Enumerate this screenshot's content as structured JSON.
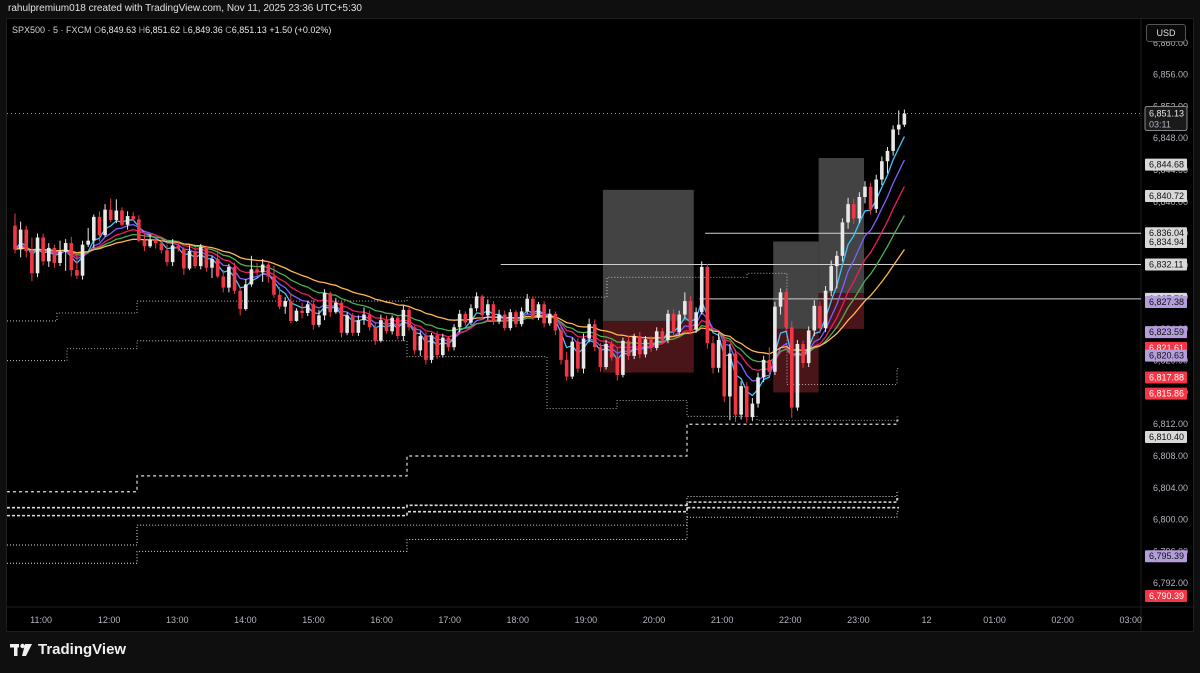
{
  "header": {
    "attribution": "rahulpremium018 created with TradingView.com, Nov 11, 2025 23:36 UTC+5:30"
  },
  "legend": {
    "symbol": "SPX500 · 5 · FXCM",
    "o_label": "O",
    "o_value": "6,849.63",
    "h_label": "H",
    "h_value": "6,851.62",
    "l_label": "L",
    "l_value": "6,849.36",
    "c_label": "C",
    "c_value": "6,851.13",
    "change": "+1.50 (+0.02%)"
  },
  "currency_button": "USD",
  "footer": {
    "brand": "TradingView"
  },
  "colors": {
    "bull": "#e8e8e8",
    "bear": "#f23645",
    "ema_fast": "#40c4ff",
    "ema_2": "#7b61ff",
    "ema_3": "#e91e63",
    "ema_4": "#4caf50",
    "ema_slow": "#ffb74d",
    "zone_grey": "#5a5a5a",
    "zone_red": "#5c1a1f"
  },
  "chart_data": {
    "type": "candlestick",
    "ylim": [
      6789,
      6863
    ],
    "y_ticks": [
      "6,860.00",
      "6,856.00",
      "6,852.00",
      "6,848.00",
      "6,844.00",
      "6,840.00",
      "6,836.00",
      "6,832.00",
      "6,828.00",
      "6,824.00",
      "6,820.00",
      "6,816.00",
      "6,812.00",
      "6,808.00",
      "6,804.00",
      "6,800.00",
      "6,796.00",
      "6,792.00"
    ],
    "x_labels": [
      "11:00",
      "12:00",
      "13:00",
      "14:00",
      "15:00",
      "16:00",
      "17:00",
      "18:00",
      "19:00",
      "20:00",
      "21:00",
      "22:00",
      "23:00",
      "12",
      "01:00",
      "02:00",
      "03:00"
    ],
    "current_price": "6,851.13",
    "countdown": "03:11",
    "price_labels": [
      {
        "value": 6844.68,
        "text": "6,844.68",
        "style": "grey"
      },
      {
        "value": 6840.72,
        "text": "6,840.72",
        "style": "grey"
      },
      {
        "value": 6836.04,
        "text": "6,836.04",
        "style": "grey"
      },
      {
        "value": 6834.94,
        "text": "6,834.94",
        "style": "grey"
      },
      {
        "value": 6832.11,
        "text": "6,832.11",
        "style": "grey"
      },
      {
        "value": 6827.78,
        "text": "6,827.78",
        "style": "grey"
      },
      {
        "value": 6827.38,
        "text": "6,827.38",
        "style": "purple"
      },
      {
        "value": 6823.59,
        "text": "6,823.59",
        "style": "purple"
      },
      {
        "value": 6821.61,
        "text": "6,821.61",
        "style": "red"
      },
      {
        "value": 6820.63,
        "text": "6,820.63",
        "style": "purple"
      },
      {
        "value": 6817.88,
        "text": "6,817.88",
        "style": "red"
      },
      {
        "value": 6815.86,
        "text": "6,815.86",
        "style": "red"
      },
      {
        "value": 6810.4,
        "text": "6,810.40",
        "style": "grey"
      },
      {
        "value": 6795.39,
        "text": "6,795.39",
        "style": "purple"
      },
      {
        "value": 6790.39,
        "text": "6,790.39",
        "style": "red"
      }
    ],
    "levels": [
      {
        "from": "17:45",
        "to": "end",
        "value": 6832.11
      },
      {
        "from": "20:45",
        "to": "end",
        "value": 6836.04
      },
      {
        "from": "20:40",
        "to": "end",
        "value": 6827.78
      }
    ],
    "zones": [
      {
        "from": "19:15",
        "to": "20:35",
        "top": 6841.5,
        "mid": 6825.0,
        "bottom": 6818.5
      },
      {
        "from": "21:45",
        "to": "22:25",
        "top": 6835.0,
        "mid": 6824.0,
        "bottom": 6816.0
      },
      {
        "from": "22:25",
        "to": "23:05",
        "top": 6845.5,
        "mid": 6828.5,
        "bottom": 6824.0
      }
    ],
    "candles": [
      [
        6837,
        6838.5,
        6833.5,
        6834
      ],
      [
        6834,
        6837.5,
        6833,
        6836.5
      ],
      [
        6836.5,
        6837,
        6833,
        6833.8
      ],
      [
        6833.8,
        6835.5,
        6830,
        6831
      ],
      [
        6831,
        6836,
        6830.5,
        6835.5
      ],
      [
        6835.5,
        6836,
        6832,
        6832.5
      ],
      [
        6832.5,
        6834.8,
        6831.8,
        6834.2
      ],
      [
        6834.2,
        6834.6,
        6831.7,
        6832.3
      ],
      [
        6832.3,
        6835.1,
        6831.9,
        6833.7
      ],
      [
        6833.7,
        6835.3,
        6831.3,
        6834.8
      ],
      [
        6834.8,
        6835.6,
        6830.6,
        6831.4
      ],
      [
        6831.4,
        6833.6,
        6830.3,
        6830.7
      ],
      [
        6830.7,
        6835.1,
        6830.2,
        6834.6
      ],
      [
        6834.6,
        6836.7,
        6834.3,
        6835.1
      ],
      [
        6835.1,
        6838.4,
        6834.2,
        6838.1
      ],
      [
        6838.1,
        6838.8,
        6835,
        6835.8
      ],
      [
        6835.8,
        6839.7,
        6835.6,
        6839
      ],
      [
        6839,
        6840.4,
        6837.4,
        6837.7
      ],
      [
        6837.7,
        6840.3,
        6837.3,
        6838.9
      ],
      [
        6838.9,
        6839.3,
        6836.9,
        6837.1
      ],
      [
        6837.1,
        6838.8,
        6836.5,
        6838.2
      ],
      [
        6838.2,
        6838.7,
        6837.6,
        6837.8
      ],
      [
        6837.8,
        6838.3,
        6834.9,
        6835.1
      ],
      [
        6835.1,
        6836,
        6833.8,
        6834.4
      ],
      [
        6834.4,
        6835.9,
        6834.2,
        6835.2
      ],
      [
        6835.2,
        6835.6,
        6834.1,
        6834.8
      ],
      [
        6834.8,
        6835.4,
        6833.5,
        6833.9
      ],
      [
        6833.9,
        6834.6,
        6831.9,
        6832.4
      ],
      [
        6832.4,
        6835.3,
        6831.9,
        6834.5
      ],
      [
        6834.5,
        6835.1,
        6833.7,
        6834.1
      ],
      [
        6834.1,
        6834.3,
        6830.8,
        6831.6
      ],
      [
        6831.6,
        6834.5,
        6831.4,
        6833.8
      ],
      [
        6833.8,
        6834.3,
        6831.6,
        6831.9
      ],
      [
        6831.9,
        6834.7,
        6831.5,
        6834.3
      ],
      [
        6834.3,
        6834.5,
        6831.2,
        6831.7
      ],
      [
        6831.7,
        6833.2,
        6830.4,
        6832.8
      ],
      [
        6832.8,
        6833.9,
        6830.4,
        6830.6
      ],
      [
        6830.6,
        6831.4,
        6828.6,
        6829.2
      ],
      [
        6829.2,
        6832.2,
        6828.6,
        6831.8
      ],
      [
        6831.8,
        6832.3,
        6828.4,
        6828.8
      ],
      [
        6828.8,
        6829.1,
        6825.7,
        6826.5
      ],
      [
        6826.5,
        6830.3,
        6826.3,
        6829.6
      ],
      [
        6829.6,
        6833.2,
        6829.3,
        6831.5
      ],
      [
        6831.5,
        6832.3,
        6830.7,
        6831.1
      ],
      [
        6831.1,
        6832.8,
        6829.9,
        6832.1
      ],
      [
        6832.1,
        6832.6,
        6829.8,
        6830.6
      ],
      [
        6830.6,
        6831.9,
        6827.9,
        6828.3
      ],
      [
        6828.3,
        6829.3,
        6826.5,
        6826.8
      ],
      [
        6826.8,
        6828,
        6825.9,
        6827.5
      ],
      [
        6827.5,
        6828.5,
        6824.7,
        6825
      ],
      [
        6825,
        6826.6,
        6824.9,
        6826.3
      ],
      [
        6826.3,
        6827.3,
        6825.3,
        6826
      ],
      [
        6826,
        6827.5,
        6825.6,
        6827.1
      ],
      [
        6827.1,
        6827.6,
        6823.9,
        6824.5
      ],
      [
        6824.5,
        6826.4,
        6824.2,
        6825.7
      ],
      [
        6825.7,
        6829,
        6825.1,
        6828.5
      ],
      [
        6828.5,
        6828.7,
        6825.5,
        6826.1
      ],
      [
        6826.1,
        6827.9,
        6825.9,
        6827.3
      ],
      [
        6827.3,
        6827.6,
        6822.9,
        6823.5
      ],
      [
        6823.5,
        6826.1,
        6823.2,
        6825.7
      ],
      [
        6825.7,
        6826,
        6823.1,
        6823.5
      ],
      [
        6823.5,
        6825.7,
        6823.1,
        6825.1
      ],
      [
        6825.1,
        6826.7,
        6824.5,
        6825.8
      ],
      [
        6825.8,
        6826.3,
        6823.8,
        6824.2
      ],
      [
        6824.2,
        6824.9,
        6822,
        6822.5
      ],
      [
        6822.5,
        6825.8,
        6822.3,
        6825.1
      ],
      [
        6825.1,
        6825.7,
        6823.4,
        6823.7
      ],
      [
        6823.7,
        6825.7,
        6823.3,
        6825.4
      ],
      [
        6825.4,
        6825.6,
        6822.7,
        6823.1
      ],
      [
        6823.1,
        6826.9,
        6822.5,
        6826.4
      ],
      [
        6826.4,
        6826.7,
        6823.8,
        6824.2
      ],
      [
        6824.2,
        6824.4,
        6820.8,
        6821.3
      ],
      [
        6821.3,
        6823.7,
        6820.6,
        6823.1
      ],
      [
        6823.1,
        6823.6,
        6819.5,
        6820.1
      ],
      [
        6820.1,
        6823.5,
        6819.7,
        6823.2
      ],
      [
        6823.2,
        6823.7,
        6820.2,
        6820.7
      ],
      [
        6820.7,
        6823.4,
        6820.4,
        6822.9
      ],
      [
        6822.9,
        6823.1,
        6821.2,
        6821.7
      ],
      [
        6821.7,
        6824.6,
        6821.3,
        6824.2
      ],
      [
        6824.2,
        6826.4,
        6823.6,
        6825.9
      ],
      [
        6825.9,
        6826.2,
        6824.4,
        6824.8
      ],
      [
        6824.8,
        6827.1,
        6824.5,
        6826.6
      ],
      [
        6826.6,
        6828.6,
        6826.2,
        6828.1
      ],
      [
        6828.1,
        6828.3,
        6825.2,
        6825.7
      ],
      [
        6825.7,
        6827.7,
        6825.1,
        6827.1
      ],
      [
        6827.1,
        6827.5,
        6824.5,
        6824.9
      ],
      [
        6824.9,
        6826.4,
        6824.6,
        6825.8
      ],
      [
        6825.8,
        6826.3,
        6823.8,
        6824.1
      ],
      [
        6824.1,
        6826.5,
        6823.8,
        6826.1
      ],
      [
        6826.1,
        6826.4,
        6824.2,
        6824.6
      ],
      [
        6824.6,
        6826.7,
        6824.3,
        6826.2
      ],
      [
        6826.2,
        6828.4,
        6825.9,
        6827.8
      ],
      [
        6827.8,
        6828.1,
        6825.1,
        6825.4
      ],
      [
        6825.4,
        6827.4,
        6825.1,
        6827.1
      ],
      [
        6827.1,
        6827.5,
        6824.2,
        6824.7
      ],
      [
        6824.7,
        6826.5,
        6824.4,
        6825.9
      ],
      [
        6825.9,
        6826.2,
        6823.2,
        6823.8
      ],
      [
        6823.8,
        6824.3,
        6819.5,
        6820.1
      ],
      [
        6820.1,
        6821.1,
        6817.5,
        6818
      ],
      [
        6818,
        6822.9,
        6817.7,
        6822.4
      ],
      [
        6822.4,
        6822.8,
        6818.5,
        6819
      ],
      [
        6819,
        6823.4,
        6818.4,
        6822.8
      ],
      [
        6822.8,
        6825.3,
        6822.3,
        6824.6
      ],
      [
        6824.6,
        6825.2,
        6821.2,
        6821.7
      ],
      [
        6821.7,
        6822.2,
        6818.6,
        6819.2
      ],
      [
        6819.2,
        6822.6,
        6818.9,
        6822.1
      ],
      [
        6822.1,
        6822.5,
        6820,
        6820.4
      ],
      [
        6820.4,
        6821.6,
        6817.5,
        6818.2
      ],
      [
        6818.2,
        6822.9,
        6817.9,
        6822.5
      ],
      [
        6822.5,
        6823.1,
        6820.1,
        6820.6
      ],
      [
        6820.6,
        6823.4,
        6820.2,
        6823.1
      ],
      [
        6823.1,
        6823.6,
        6820.3,
        6820.8
      ],
      [
        6820.8,
        6823.1,
        6820.4,
        6822.7
      ],
      [
        6822.7,
        6823.1,
        6821.1,
        6821.6
      ],
      [
        6821.6,
        6824.2,
        6821.3,
        6823.7
      ],
      [
        6823.7,
        6824.1,
        6822.2,
        6822.6
      ],
      [
        6822.6,
        6826.4,
        6822.2,
        6825.9
      ],
      [
        6825.9,
        6826.5,
        6823.2,
        6823.6
      ],
      [
        6823.6,
        6826.3,
        6823.2,
        6825.8
      ],
      [
        6825.8,
        6828.6,
        6825.3,
        6827.5
      ],
      [
        6827.5,
        6828.1,
        6823.3,
        6823.9
      ],
      [
        6823.9,
        6826.7,
        6823.5,
        6826.1
      ],
      [
        6826.1,
        6832.5,
        6825.8,
        6831.8
      ],
      [
        6831.8,
        6832.2,
        6821.5,
        6822.2
      ],
      [
        6822.2,
        6823.1,
        6818.4,
        6819.1
      ],
      [
        6819.1,
        6823.5,
        6818.5,
        6822.6
      ],
      [
        6822.6,
        6823.1,
        6814.8,
        6815.5
      ],
      [
        6815.5,
        6822.1,
        6812.5,
        6820.9
      ],
      [
        6820.9,
        6821.4,
        6812.3,
        6813.2
      ],
      [
        6813.2,
        6817.4,
        6812.6,
        6816.8
      ],
      [
        6816.8,
        6817.3,
        6812.2,
        6812.9
      ],
      [
        6812.9,
        6815.3,
        6812.4,
        6814.6
      ],
      [
        6814.6,
        6818.5,
        6814.1,
        6817.9
      ],
      [
        6817.9,
        6820.6,
        6817.3,
        6820.1
      ],
      [
        6820.1,
        6821.7,
        6818.1,
        6818.6
      ],
      [
        6818.6,
        6827.4,
        6818.2,
        6826.8
      ],
      [
        6826.8,
        6829.1,
        6825.8,
        6828.6
      ],
      [
        6828.6,
        6829,
        6823.7,
        6824.2
      ],
      [
        6824.2,
        6825,
        6812.8,
        6814.1
      ],
      [
        6814.1,
        6822.6,
        6813.7,
        6822.1
      ],
      [
        6822.1,
        6822.5,
        6819.1,
        6819.7
      ],
      [
        6819.7,
        6824.3,
        6819.2,
        6823.8
      ],
      [
        6823.8,
        6827.6,
        6823.1,
        6826.9
      ],
      [
        6826.9,
        6827.5,
        6823.4,
        6824.1
      ],
      [
        6824.1,
        6829.4,
        6823.6,
        6828.8
      ],
      [
        6828.8,
        6832.6,
        6828.1,
        6831.9
      ],
      [
        6831.9,
        6833.8,
        6829.1,
        6833.2
      ],
      [
        6833.2,
        6837.9,
        6832.5,
        6837.4
      ],
      [
        6837.4,
        6840.5,
        6836.6,
        6839.7
      ],
      [
        6839.7,
        6840.4,
        6837.2,
        6837.9
      ],
      [
        6837.9,
        6841.2,
        6837.3,
        6840.6
      ],
      [
        6840.6,
        6842.6,
        6839.8,
        6841.9
      ],
      [
        6841.9,
        6842.4,
        6838.4,
        6839.1
      ],
      [
        6839.1,
        6843.4,
        6838.6,
        6842.8
      ],
      [
        6842.8,
        6845.7,
        6842.1,
        6845.1
      ],
      [
        6845.1,
        6846.9,
        6843.6,
        6846.4
      ],
      [
        6846.4,
        6849.6,
        6845.8,
        6849.1
      ],
      [
        6849.1,
        6851.5,
        6848.4,
        6849.7
      ],
      [
        6849.7,
        6851.6,
        6849.4,
        6851.1
      ]
    ]
  }
}
